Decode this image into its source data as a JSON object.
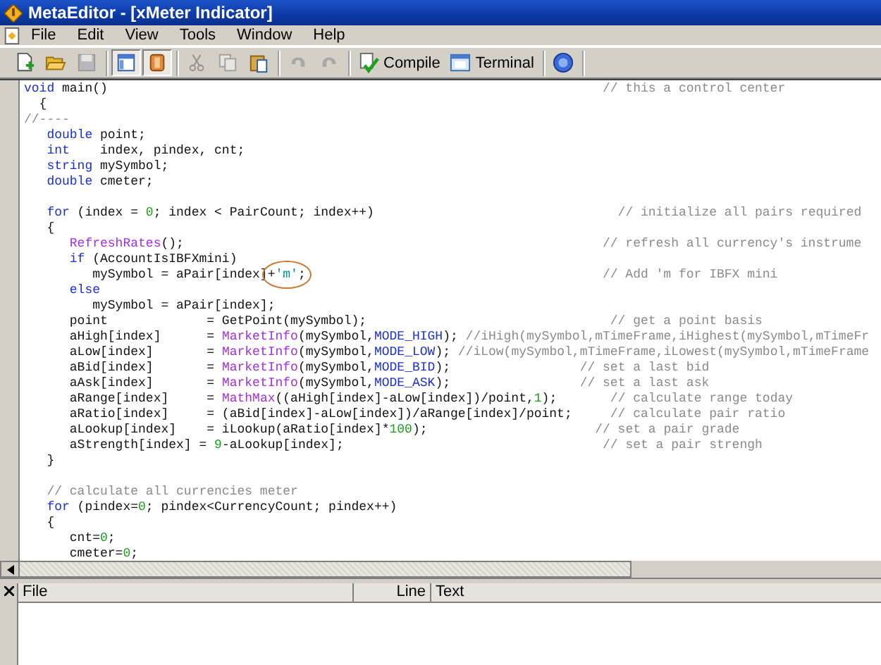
{
  "window": {
    "title": "MetaEditor - [xMeter Indicator]"
  },
  "menu": [
    "File",
    "Edit",
    "View",
    "Tools",
    "Window",
    "Help"
  ],
  "toolbar": [
    [
      {
        "kind": "new",
        "disabled": false,
        "pressed": false
      },
      {
        "kind": "open",
        "disabled": false,
        "pressed": false
      },
      {
        "kind": "save",
        "disabled": true,
        "pressed": false
      }
    ],
    [
      {
        "kind": "navigator",
        "disabled": false,
        "pressed": true
      },
      {
        "kind": "toolbox",
        "disabled": false,
        "pressed": true
      }
    ],
    [
      {
        "kind": "cut",
        "disabled": true,
        "pressed": false
      },
      {
        "kind": "copy",
        "disabled": true,
        "pressed": false
      },
      {
        "kind": "paste",
        "disabled": false,
        "pressed": false
      }
    ],
    [
      {
        "kind": "undo",
        "disabled": true,
        "pressed": false
      },
      {
        "kind": "redo",
        "disabled": true,
        "pressed": false
      }
    ],
    [
      {
        "kind": "compile",
        "label": "Compile",
        "disabled": false,
        "pressed": false
      },
      {
        "kind": "terminal",
        "label": "Terminal",
        "disabled": false,
        "pressed": false
      }
    ],
    [
      {
        "kind": "community",
        "disabled": false,
        "pressed": false
      }
    ]
  ],
  "code": [
    [
      [
        {
          "kind": "keyword",
          "text": "void"
        },
        {
          "kind": "plain",
          "text": " main()"
        },
        {
          "kind": "comment",
          "text": "                                                                 // this a control center"
        }
      ],
      [
        {
          "kind": "plain",
          "text": "  {"
        }
      ],
      [
        {
          "kind": "comment",
          "text": "//----"
        }
      ],
      [
        {
          "kind": "keyword",
          "text": "   double"
        },
        {
          "kind": "plain",
          "text": " point;"
        }
      ],
      [
        {
          "kind": "keyword",
          "text": "   int"
        },
        {
          "kind": "plain",
          "text": "    index, pindex, cnt;"
        }
      ],
      [
        {
          "kind": "keyword",
          "text": "   string"
        },
        {
          "kind": "plain",
          "text": " mySymbol;"
        }
      ],
      [
        {
          "kind": "keyword",
          "text": "   double"
        },
        {
          "kind": "plain",
          "text": " cmeter;"
        }
      ]
    ],
    [
      [
        {
          "kind": "keyword",
          "text": "   for"
        },
        {
          "kind": "plain",
          "text": " (index = "
        },
        {
          "kind": "number",
          "text": "0"
        },
        {
          "kind": "plain",
          "text": "; index < PairCount; index++)"
        },
        {
          "kind": "comment",
          "text": "                                // initialize all pairs required"
        }
      ],
      [
        {
          "kind": "plain",
          "text": "   {"
        }
      ],
      [
        {
          "kind": "function",
          "text": "      RefreshRates"
        },
        {
          "kind": "plain",
          "text": "();"
        },
        {
          "kind": "comment",
          "text": "                                                       // refresh all currency's instrume"
        }
      ],
      [
        {
          "kind": "keyword",
          "text": "      if"
        },
        {
          "kind": "plain",
          "text": " (AccountIsIBFXmini)"
        }
      ],
      [
        {
          "kind": "plain",
          "text": "         mySymbol = aPair[index]"
        },
        {
          "kind": "plain",
          "text": "+",
          "circled": true
        },
        {
          "kind": "string",
          "text": "'m'",
          "circled": true
        },
        {
          "kind": "plain",
          "text": ";",
          "circled": true
        },
        {
          "kind": "comment",
          "text": "                                       // Add 'm for IBFX mini"
        }
      ],
      [
        {
          "kind": "keyword",
          "text": "      else"
        }
      ],
      [
        {
          "kind": "plain",
          "text": "         mySymbol = aPair[index];"
        }
      ],
      [
        {
          "kind": "plain",
          "text": "      point             = GetPoint(mySymbol);"
        },
        {
          "kind": "comment",
          "text": "                                // get a point basis"
        }
      ],
      [
        {
          "kind": "plain",
          "text": "      aHigh[index]      = "
        },
        {
          "kind": "function",
          "text": "MarketInfo"
        },
        {
          "kind": "plain",
          "text": "(mySymbol,"
        },
        {
          "kind": "keyword",
          "text": "MODE_HIGH"
        },
        {
          "kind": "plain",
          "text": ");"
        },
        {
          "kind": "comment",
          "text": " //iHigh(mySymbol,mTimeFrame,iHighest(mySymbol,mTimeFr"
        }
      ],
      [
        {
          "kind": "plain",
          "text": "      aLow[index]       = "
        },
        {
          "kind": "function",
          "text": "MarketInfo"
        },
        {
          "kind": "plain",
          "text": "(mySymbol,"
        },
        {
          "kind": "keyword",
          "text": "MODE_LOW"
        },
        {
          "kind": "plain",
          "text": ");"
        },
        {
          "kind": "comment",
          "text": " //iLow(mySymbol,mTimeFrame,iLowest(mySymbol,mTimeFrame"
        }
      ],
      [
        {
          "kind": "plain",
          "text": "      aBid[index]       = "
        },
        {
          "kind": "function",
          "text": "MarketInfo"
        },
        {
          "kind": "plain",
          "text": "(mySymbol,"
        },
        {
          "kind": "keyword",
          "text": "MODE_BID"
        },
        {
          "kind": "plain",
          "text": ");"
        },
        {
          "kind": "comment",
          "text": "                 // set a last bid"
        }
      ],
      [
        {
          "kind": "plain",
          "text": "      aAsk[index]       = "
        },
        {
          "kind": "function",
          "text": "MarketInfo"
        },
        {
          "kind": "plain",
          "text": "(mySymbol,"
        },
        {
          "kind": "keyword",
          "text": "MODE_ASK"
        },
        {
          "kind": "plain",
          "text": ");"
        },
        {
          "kind": "comment",
          "text": "                 // set a last ask"
        }
      ],
      [
        {
          "kind": "plain",
          "text": "      aRange[index]     = "
        },
        {
          "kind": "function",
          "text": "MathMax"
        },
        {
          "kind": "plain",
          "text": "((aHigh[index]-aLow[index])/point,"
        },
        {
          "kind": "number",
          "text": "1"
        },
        {
          "kind": "plain",
          "text": ");"
        },
        {
          "kind": "comment",
          "text": "       // calculate range today"
        }
      ],
      [
        {
          "kind": "plain",
          "text": "      aRatio[index]     = (aBid[index]-aLow[index])/aRange[index]/point;"
        },
        {
          "kind": "comment",
          "text": "     // calculate pair ratio"
        }
      ],
      [
        {
          "kind": "plain",
          "text": "      aLookup[index]    = iLookup(aRatio[index]*"
        },
        {
          "kind": "number",
          "text": "100"
        },
        {
          "kind": "plain",
          "text": ");"
        },
        {
          "kind": "comment",
          "text": "                      // set a pair grade"
        }
      ],
      [
        {
          "kind": "plain",
          "text": "      aStrength[index] = "
        },
        {
          "kind": "number",
          "text": "9"
        },
        {
          "kind": "plain",
          "text": "-aLookup[index];"
        },
        {
          "kind": "comment",
          "text": "                                  // set a pair strengh"
        }
      ],
      [
        {
          "kind": "plain",
          "text": "   }"
        }
      ]
    ],
    [
      [
        {
          "kind": "comment",
          "text": "   // calculate all currencies meter"
        }
      ],
      [
        {
          "kind": "keyword",
          "text": "   for"
        },
        {
          "kind": "plain",
          "text": " (pindex="
        },
        {
          "kind": "number",
          "text": "0"
        },
        {
          "kind": "plain",
          "text": "; pindex<CurrencyCount; pindex++)"
        }
      ],
      [
        {
          "kind": "plain",
          "text": "   {"
        }
      ],
      [
        {
          "kind": "plain",
          "text": "      cnt="
        },
        {
          "kind": "number",
          "text": "0"
        },
        {
          "kind": "plain",
          "text": ";"
        }
      ],
      [
        {
          "kind": "plain",
          "text": "      cmeter="
        },
        {
          "kind": "number",
          "text": "0"
        },
        {
          "kind": "plain",
          "text": ";"
        }
      ]
    ]
  ],
  "output_panel": {
    "columns": [
      "File",
      "Line",
      "Text"
    ]
  }
}
